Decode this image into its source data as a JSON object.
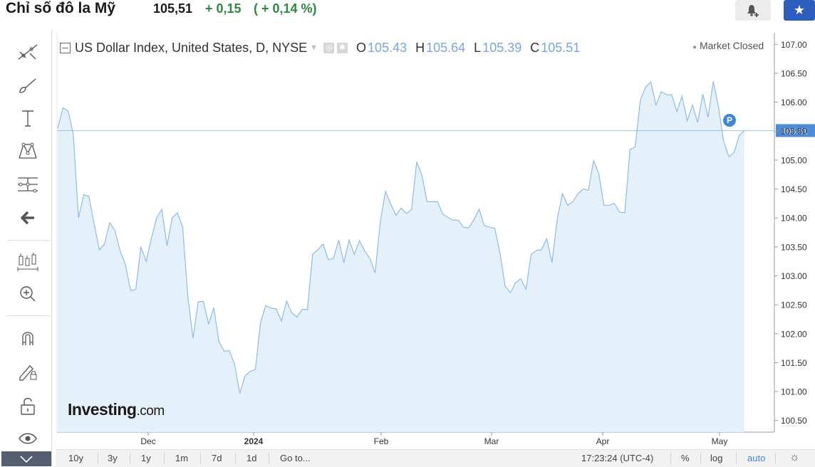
{
  "header": {
    "title": "Chỉ số đô la Mỹ",
    "price": "105,51",
    "change": "+ 0,15",
    "change_pct": "( + 0,14 %)",
    "alert_icon": "bell-plus-icon",
    "watchlist_icon": "star-icon",
    "change_color": "#2b8a3e"
  },
  "legend": {
    "symbol": "US Dollar Index, United States, D, NYSE",
    "open_key": "O",
    "open": "105.43",
    "high_key": "H",
    "high": "105.64",
    "low_key": "L",
    "low": "105.39",
    "close_key": "C",
    "close": "105.51",
    "market_status": "Market Closed",
    "value_color": "#76a6dc"
  },
  "toolbar": {
    "tools": [
      "trend-line-icon",
      "brush-icon",
      "text-icon",
      "pattern-icon",
      "fib-levels-icon",
      "back-arrow-icon",
      "indicators-icon",
      "zoom-in-icon",
      "magnet-icon",
      "lock-drawing-icon",
      "unlock-icon",
      "eye-icon"
    ],
    "collapse_icon": "chevron-down-icon"
  },
  "watermark": {
    "brand": "Investing",
    "suffix": ".com"
  },
  "price_badge": "P",
  "bottom_bar": {
    "ranges": [
      "10y",
      "3y",
      "1y",
      "1m",
      "7d",
      "1d"
    ],
    "goto": "Go to...",
    "time": "17:23:24 (UTC-4)",
    "percent": "%",
    "log": "log",
    "auto": "auto",
    "settings_icon": "gear-icon"
  },
  "chart_data": {
    "type": "area",
    "title": "US Dollar Index, United States, D, NYSE",
    "xlabel": "",
    "ylabel": "",
    "x_ticks": [
      "Dec",
      "2024",
      "Feb",
      "Mar",
      "Apr",
      "May"
    ],
    "y_ticks": [
      "100.50",
      "101.00",
      "101.50",
      "102.00",
      "102.50",
      "103.00",
      "103.50",
      "104.00",
      "104.50",
      "105.00",
      "105.50",
      "106.00",
      "106.50",
      "107.00"
    ],
    "ylim": [
      100.3,
      107.2
    ],
    "last_price_label": "105.51",
    "last_price": 105.51,
    "series": [
      {
        "values": [
          105.55,
          105.9,
          105.85,
          105.45,
          104.0,
          104.4,
          104.37,
          103.9,
          103.45,
          103.55,
          103.92,
          103.78,
          103.43,
          103.2,
          102.75,
          102.76,
          103.5,
          103.25,
          103.65,
          104.0,
          104.15,
          103.52,
          104.0,
          104.09,
          103.85,
          102.65,
          101.92,
          102.55,
          102.56,
          102.17,
          102.45,
          101.86,
          101.7,
          101.71,
          101.47,
          100.97,
          101.27,
          101.35,
          101.38,
          102.2,
          102.49,
          102.44,
          102.43,
          102.22,
          102.56,
          102.36,
          102.29,
          102.42,
          102.42,
          103.37,
          103.45,
          103.55,
          103.28,
          103.3,
          103.62,
          103.23,
          103.62,
          103.37,
          103.61,
          103.43,
          103.3,
          103.05,
          103.93,
          104.46,
          104.24,
          104.05,
          104.17,
          104.08,
          104.14,
          104.97,
          104.74,
          104.28,
          104.28,
          104.28,
          104.07,
          104.01,
          103.96,
          103.96,
          103.84,
          103.83,
          103.97,
          104.15,
          103.87,
          103.84,
          103.82,
          103.4,
          102.82,
          102.71,
          102.88,
          102.95,
          102.77,
          103.37,
          103.44,
          103.45,
          103.64,
          103.23,
          103.97,
          104.42,
          104.22,
          104.28,
          104.42,
          104.5,
          104.48,
          104.99,
          104.76,
          104.22,
          104.22,
          104.25,
          104.1,
          104.09,
          105.18,
          105.23,
          106.04,
          106.26,
          106.35,
          105.95,
          106.18,
          106.13,
          106.13,
          105.84,
          106.1,
          105.68,
          105.95,
          105.65,
          106.14,
          105.74,
          106.36,
          105.92,
          105.32,
          105.06,
          105.13,
          105.43,
          105.51
        ]
      }
    ]
  }
}
